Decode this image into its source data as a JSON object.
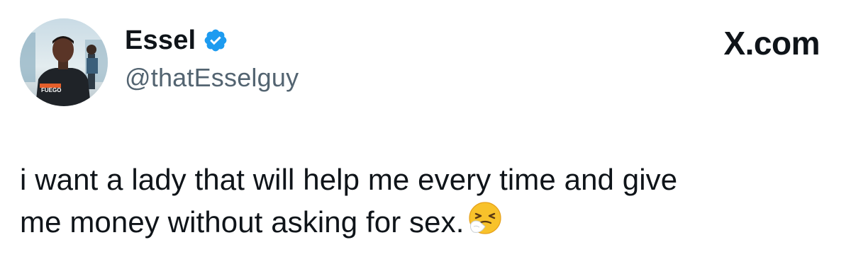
{
  "author": {
    "display_name": "Essel",
    "handle": "@thatEsselguy",
    "verified": true,
    "verified_icon": "verified-badge-icon",
    "verified_color": "#1d9bf0",
    "avatar": "profile-photo",
    "avatar_shirt_text": "FUEGO"
  },
  "brand": {
    "label": "X.com"
  },
  "tweet": {
    "line1": "i want a lady that will help me every time and give",
    "line2": "me money without asking for sex.",
    "emoji": "sneezing-face-emoji"
  },
  "colors": {
    "text_primary": "#0f1419",
    "text_secondary": "#536471",
    "accent": "#1d9bf0"
  }
}
